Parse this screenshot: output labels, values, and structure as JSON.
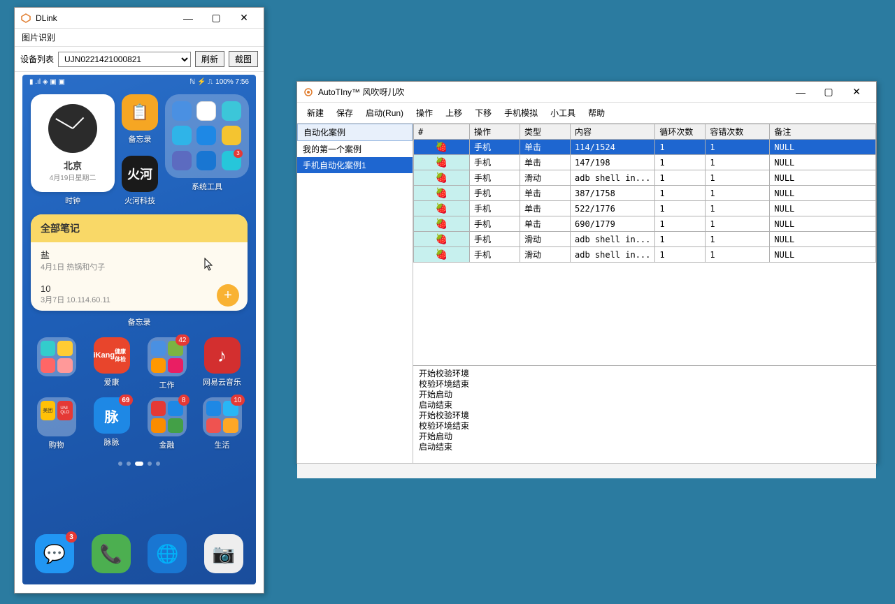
{
  "dlink": {
    "title": "DLink",
    "menu": {
      "image_recog": "图片识别"
    },
    "toolbar": {
      "device_list_label": "设备列表",
      "device_value": "UJN0221421000821",
      "refresh": "刷新",
      "screenshot": "截图"
    },
    "phone": {
      "status_right": "100%  7:56",
      "clock": {
        "label": "时钟",
        "city": "北京",
        "date": "4月19日星期二"
      },
      "memo_tile": "备忘录",
      "huohe": {
        "top": "火河",
        "label": "火河科技"
      },
      "sys_folder": "系统工具",
      "notes": {
        "header": "全部笔记",
        "n1_title": "盐",
        "n1_sub": "4月1日 热锅和勺子",
        "n2_title": "10",
        "n2_sub": "3月7日 10.114.60.11",
        "panel_label": "备忘录"
      },
      "row_labels": {
        "ikang": "爱康",
        "work": "工作",
        "netease": "网易云音乐",
        "shopping": "购物",
        "maimai": "脉脉",
        "finance": "金融",
        "life": "生活"
      },
      "badges": {
        "work": "42",
        "maimai": "69",
        "finance": "8",
        "life": "10",
        "messages": "3"
      }
    }
  },
  "autotiny": {
    "title": "AutoTIny™ 风吹呀儿吹",
    "menu": [
      "新建",
      "保存",
      "启动(Run)",
      "操作",
      "上移",
      "下移",
      "手机模拟",
      "小工具",
      "帮助"
    ],
    "left_header": "自动化案例",
    "cases": [
      "我的第一个案例",
      "手机自动化案例1"
    ],
    "selected_case_index": 1,
    "columns": [
      "#",
      "操作",
      "类型",
      "内容",
      "循环次数",
      "容错次数",
      "备注"
    ],
    "rows": [
      {
        "op": "手机",
        "type": "单击",
        "content": "114/1524",
        "loop": "1",
        "err": "1",
        "note": "NULL"
      },
      {
        "op": "手机",
        "type": "单击",
        "content": "147/198",
        "loop": "1",
        "err": "1",
        "note": "NULL"
      },
      {
        "op": "手机",
        "type": "滑动",
        "content": "adb shell in...",
        "loop": "1",
        "err": "1",
        "note": "NULL"
      },
      {
        "op": "手机",
        "type": "单击",
        "content": "387/1758",
        "loop": "1",
        "err": "1",
        "note": "NULL"
      },
      {
        "op": "手机",
        "type": "单击",
        "content": "522/1776",
        "loop": "1",
        "err": "1",
        "note": "NULL"
      },
      {
        "op": "手机",
        "type": "单击",
        "content": "690/1779",
        "loop": "1",
        "err": "1",
        "note": "NULL"
      },
      {
        "op": "手机",
        "type": "滑动",
        "content": "adb shell in...",
        "loop": "1",
        "err": "1",
        "note": "NULL"
      },
      {
        "op": "手机",
        "type": "滑动",
        "content": "adb shell in...",
        "loop": "1",
        "err": "1",
        "note": "NULL"
      }
    ],
    "selected_row_index": 0,
    "log": [
      "开始校验环境",
      "校验环境结束",
      "开始启动",
      "启动结束",
      "开始校验环境",
      "校验环境结束",
      "开始启动",
      "启动结束"
    ]
  }
}
